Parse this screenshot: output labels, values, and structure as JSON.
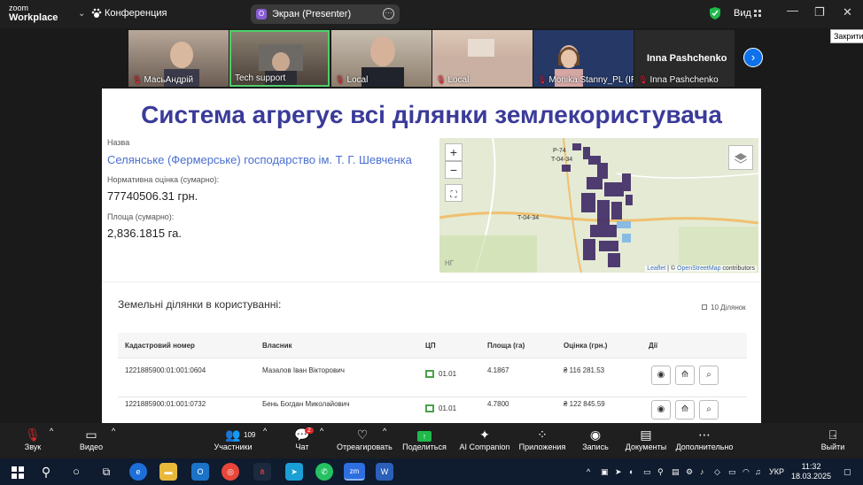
{
  "topbar": {
    "logo_line1": "zoom",
    "logo_line2": "Workplace",
    "meeting_label": "Конференция",
    "presenter_icon": "O",
    "presenter_label": "Экран (Presenter)",
    "view_label": "Вид",
    "close_tooltip": "Закрити"
  },
  "participants": [
    {
      "name": "МасьАндрій"
    },
    {
      "name": "Tech support"
    },
    {
      "name": "Local"
    },
    {
      "name": "Local"
    },
    {
      "name": "Monika Stanny_PL (IR..."
    },
    {
      "name": "Inna Pashchenko",
      "title": "Inna Pashchenko"
    }
  ],
  "slide": {
    "title": "Система агрегує всі ділянки землекористувача",
    "name_label": "Назва",
    "name_value": "Селянське (Фермерське) господарство ім. Т. Г. Шевченка",
    "assessment_label": "Нормативна оцінка (сумарно):",
    "assessment_value": "77740506.31 грн.",
    "area_label": "Площа (сумарно):",
    "area_value": "2,836.1815 га.",
    "map": {
      "zoom_in": "+",
      "zoom_out": "−",
      "road1": "P-74",
      "road2": "T-04-34",
      "road3": "T-04-34",
      "place": "НГ",
      "attribution_leaflet": "Leaflet",
      "attribution_sep": " | © ",
      "attribution_osm": "OpenStreetMap",
      "attribution_tail": " contributors"
    },
    "section_title": "Земельні ділянки в користуванні:",
    "count_label": "10 Ділянок",
    "columns": [
      "Кадастровий номер",
      "Власник",
      "ЦП",
      "Площа (га)",
      "Оцінка (грн.)",
      "Дії"
    ],
    "rows": [
      {
        "cadastral": "1221885900:01:001:0604",
        "owner": "Мазалов Іван Вікторович",
        "cp": "01.01",
        "area": "4.1867",
        "value": "₴ 116 281.53"
      },
      {
        "cadastral": "1221885900:01:001:0732",
        "owner": "Бень Богдан Миколайович",
        "cp": "01.01",
        "area": "4.7800",
        "value": "₴ 122 845.59"
      }
    ]
  },
  "toolbar": {
    "sound": "Звук",
    "video": "Видео",
    "participants": "Участники",
    "participants_count": "109",
    "chat": "Чат",
    "chat_badge": "2",
    "react": "Отреагировать",
    "share": "Поделиться",
    "ai": "AI Companion",
    "apps": "Приложения",
    "record": "Запись",
    "docs": "Документы",
    "more": "Дополнительно",
    "exit": "Выйти"
  },
  "taskbar": {
    "lang": "УКР",
    "time": "11:32",
    "date": "18.03.2025"
  },
  "colors": {
    "zoom_blue": "#0e71eb",
    "title_purple": "#3b3b9a",
    "link_blue": "#4a6fd0",
    "mute_red": "#e02828"
  }
}
